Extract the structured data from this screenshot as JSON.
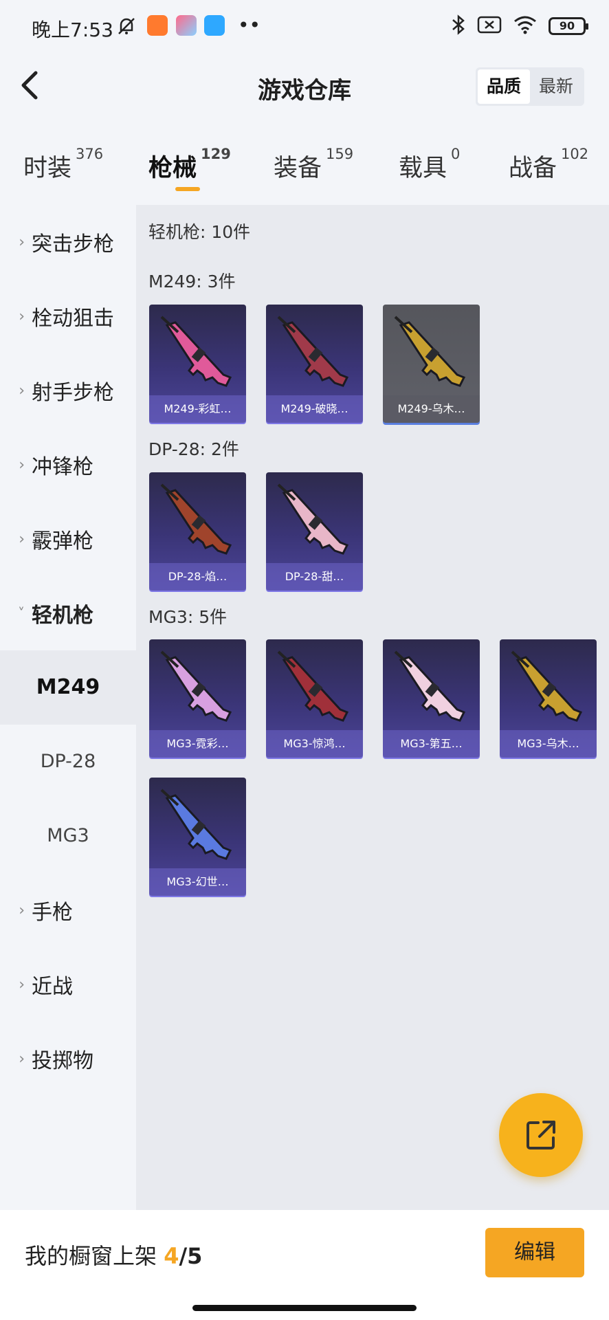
{
  "status_bar": {
    "time": "晚上7:53",
    "battery": "90",
    "icons": [
      "mute-bell-icon",
      "taobao-app-icon",
      "game-app-icon",
      "chat-app-icon",
      "more-dots-icon",
      "bluetooth-icon",
      "sim-x-icon",
      "wifi-icon",
      "battery-icon"
    ]
  },
  "header": {
    "title": "游戏仓库",
    "sort_options": [
      "品质",
      "最新"
    ],
    "sort_selected": "品质"
  },
  "tabs": [
    {
      "label": "时装",
      "count": "376"
    },
    {
      "label": "枪械",
      "count": "129",
      "active": true
    },
    {
      "label": "装备",
      "count": "159"
    },
    {
      "label": "载具",
      "count": "0"
    },
    {
      "label": "战备",
      "count": "102"
    }
  ],
  "sidebar": {
    "items": [
      {
        "label": "突击步枪"
      },
      {
        "label": "栓动狙击"
      },
      {
        "label": "射手步枪"
      },
      {
        "label": "冲锋枪"
      },
      {
        "label": "霰弹枪"
      },
      {
        "label": "轻机枪",
        "expanded": true
      },
      {
        "label": "手枪"
      },
      {
        "label": "近战"
      },
      {
        "label": "投掷物"
      }
    ],
    "sub_items": [
      {
        "label": "M249",
        "active": true
      },
      {
        "label": "DP-28"
      },
      {
        "label": "MG3"
      }
    ]
  },
  "content": {
    "category_title": "轻机枪: 10件",
    "groups": [
      {
        "title": "M249: 3件",
        "items": [
          {
            "name": "M249-彩虹…",
            "color": "#e05a9a"
          },
          {
            "name": "M249-破晓…",
            "color": "#a03a4a"
          },
          {
            "name": "M249-乌木…",
            "color": "#c8a030",
            "gray": true
          }
        ]
      },
      {
        "title": "DP-28: 2件",
        "items": [
          {
            "name": "DP-28-焰…",
            "color": "#a0442c"
          },
          {
            "name": "DP-28-甜…",
            "color": "#e8b6c8"
          }
        ]
      },
      {
        "title": "MG3: 5件",
        "items": [
          {
            "name": "MG3-霓彩…",
            "color": "#d8a0e0"
          },
          {
            "name": "MG3-惊鸿…",
            "color": "#a0303a"
          },
          {
            "name": "MG3-第五…",
            "color": "#f0d0e0"
          },
          {
            "name": "MG3-乌木…",
            "color": "#c8a030"
          },
          {
            "name": "MG3-幻世…",
            "color": "#5a7ae0"
          }
        ]
      }
    ]
  },
  "bottom": {
    "shelf_label": "我的橱窗上架",
    "shelf_count": "4",
    "shelf_total": "/5",
    "edit_label": "编辑"
  },
  "colors": {
    "accent": "#f5a623",
    "card_bg": "#3b3578"
  }
}
